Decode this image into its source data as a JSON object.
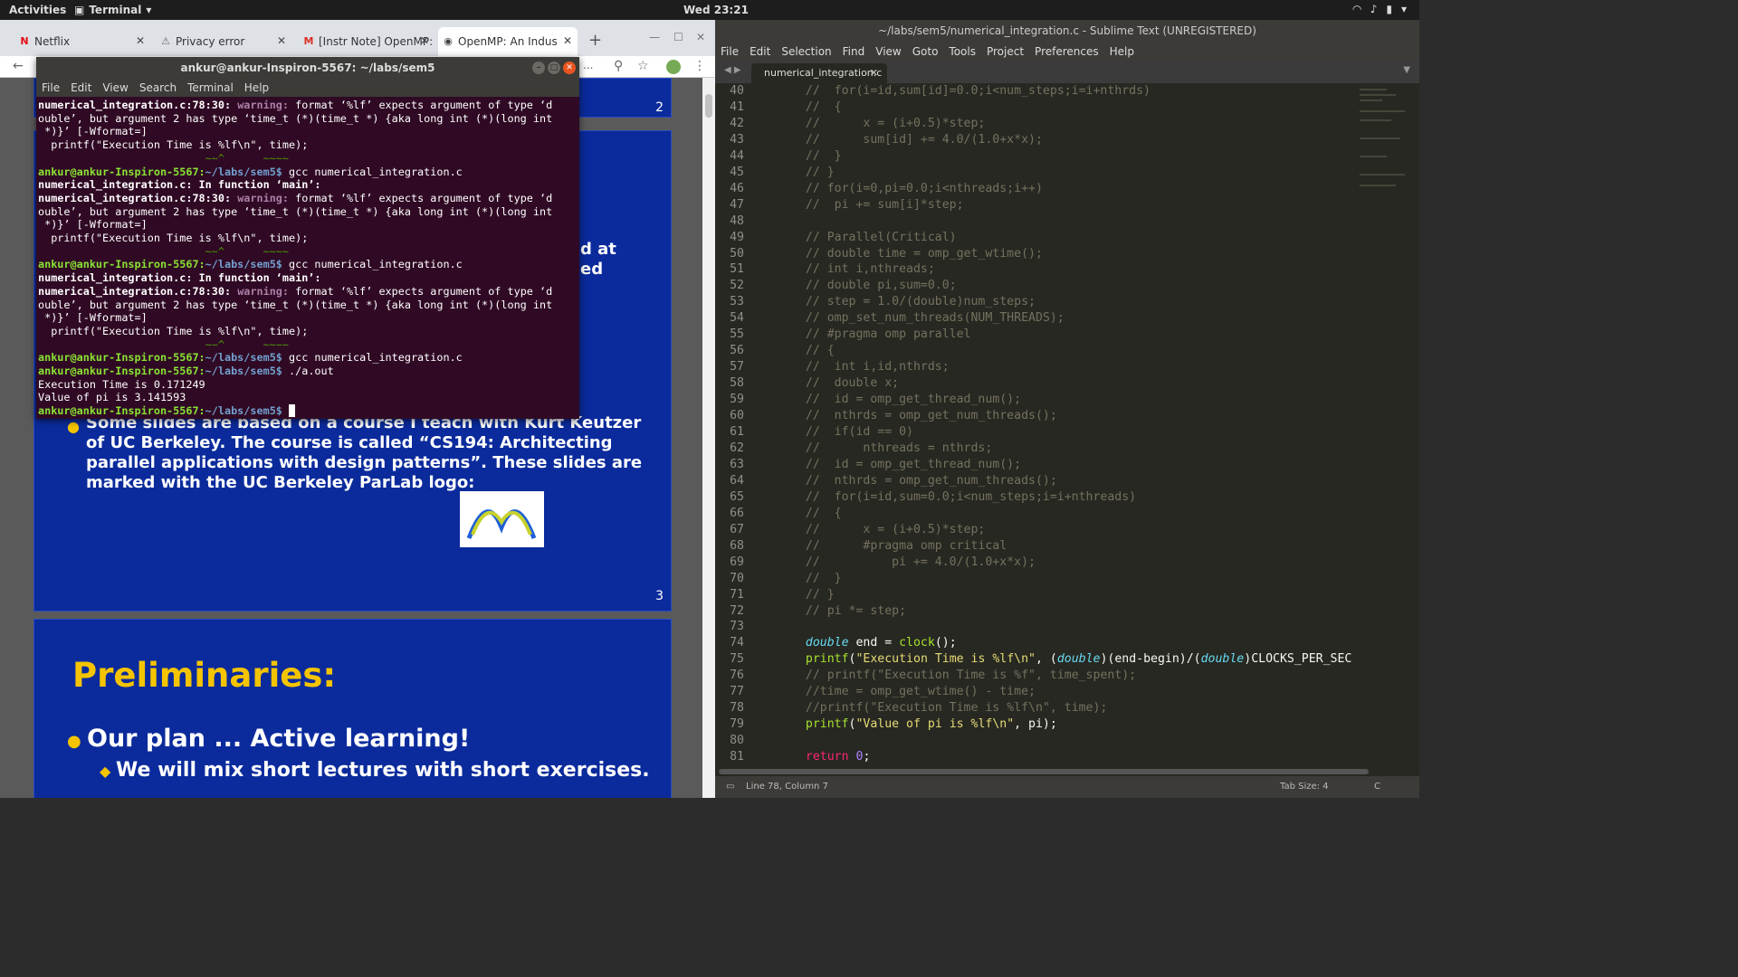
{
  "topbar": {
    "activities": "Activities",
    "app": "Terminal",
    "clock": "Wed 23:21"
  },
  "chrome": {
    "tabs": [
      {
        "label": "Netflix",
        "icon": "N"
      },
      {
        "label": "Privacy error",
        "icon": "⚠"
      },
      {
        "label": "[Instr Note] OpenMP:",
        "icon": "M"
      },
      {
        "label": "OpenMP: An Indus",
        "icon": "◉"
      }
    ],
    "omni_tail": "...",
    "slides": {
      "num2": "2",
      "num3": "3",
      "frag1": "d at",
      "frag2": "ed",
      "bullet": "Some slides are based on a course I teach with Kurt Keutzer of UC Berkeley.  The course is called “CS194: Architecting parallel applications with design patterns”.  These slides are marked with the UC Berkeley ParLab logo:",
      "prelim": "Preliminaries:",
      "plan": "Our plan ... Active learning!",
      "mix": "We will mix short lectures with short exercises."
    }
  },
  "terminal": {
    "title": "ankur@ankur-Inspiron-5567: ~/labs/sem5",
    "menu": [
      "File",
      "Edit",
      "View",
      "Search",
      "Terminal",
      "Help"
    ],
    "prompt": "ankur@ankur-Inspiron-5567:",
    "path": "~/labs/sem5$",
    "cmd_gcc": "gcc numerical_integration.c",
    "cmd_run": "./a.out",
    "file_loc": "numerical_integration.c:78:30:",
    "warn": "warning:",
    "warn_msg": "format ‘%lf’ expects argument of type ‘d",
    "warn_msg2": "ouble’, but argument 2 has type ‘time_t (*)(time_t *) {aka long int (*)(long int",
    "warn_msg3": " *)}’ [-Wformat=]",
    "in_func": "numerical_integration.c: In function ‘main’:",
    "printf_line": "  printf(\"Execution Time is %lf\\n\", time);",
    "carets": "                          ~~^      ~~~~",
    "out1": "Execution Time is 0.171249",
    "out2": "Value of pi is 3.141593"
  },
  "sublime": {
    "title": "~/labs/sem5/numerical_integration.c - Sublime Text (UNREGISTERED)",
    "menu": [
      "File",
      "Edit",
      "Selection",
      "Find",
      "View",
      "Goto",
      "Tools",
      "Project",
      "Preferences",
      "Help"
    ],
    "tab": "numerical_integration.c",
    "status_left": "Line 78, Column 7",
    "status_tab": "Tab Size: 4",
    "status_lang": "C",
    "first_line": 40,
    "lines": [
      "  //  for(i=id,sum[id]=0.0;i<num_steps;i=i+nthrds)",
      "  //  {",
      "  //      x = (i+0.5)*step;",
      "  //      sum[id] += 4.0/(1.0+x*x);",
      "  //  }",
      "  // }",
      "  // for(i=0,pi=0.0;i<nthreads;i++)",
      "  //  pi += sum[i]*step;",
      "",
      "  // Parallel(Critical)",
      "  // double time = omp_get_wtime();",
      "  // int i,nthreads;",
      "  // double pi,sum=0.0;",
      "  // step = 1.0/(double)num_steps;",
      "  // omp_set_num_threads(NUM_THREADS);",
      "  // #pragma omp parallel",
      "  // {",
      "  //  int i,id,nthrds;",
      "  //  double x;",
      "  //  id = omp_get_thread_num();",
      "  //  nthrds = omp_get_num_threads();",
      "  //  if(id == 0)",
      "  //      nthreads = nthrds;",
      "  //  id = omp_get_thread_num();",
      "  //  nthrds = omp_get_num_threads();",
      "  //  for(i=id,sum=0.0;i<num_steps;i=i+nthreads)",
      "  //  {",
      "  //      x = (i+0.5)*step;",
      "  //      #pragma omp critical",
      "  //          pi += 4.0/(1.0+x*x);",
      "  //  }",
      "  // }",
      "  // pi *= step;",
      "",
      "  double end = clock();",
      "  printf(\"Execution Time is %lf\\n\", (double)(end-begin)/(double)CLOCKS_PER_SEC",
      "  // printf(\"Execution Time is %f\", time_spent);",
      "  //time = omp_get_wtime() - time;",
      "  //printf(\"Execution Time is %lf\\n\", time);",
      "  printf(\"Value of pi is %lf\\n\", pi);",
      "",
      "  return 0;"
    ]
  }
}
